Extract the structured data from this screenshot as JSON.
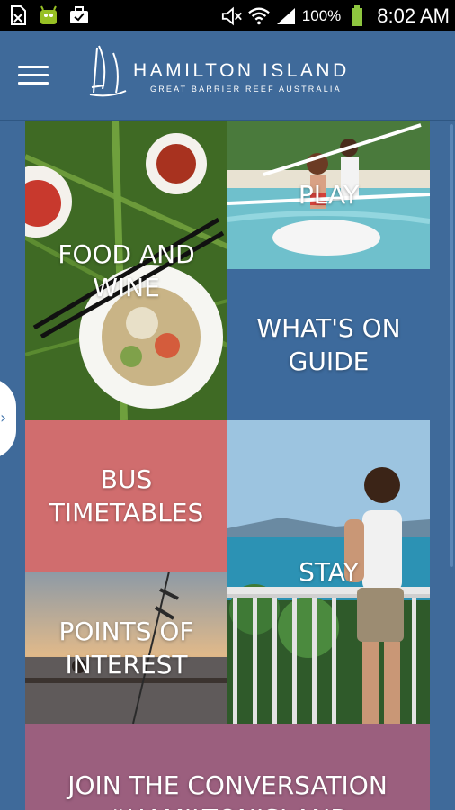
{
  "status": {
    "battery": "100%",
    "time": "8:02 AM",
    "icons": [
      "sim-card-icon",
      "android-icon",
      "briefcase-icon",
      "mute-icon",
      "wifi-icon",
      "signal-icon",
      "battery-icon"
    ]
  },
  "header": {
    "title": "HAMILTON ISLAND",
    "subtitle": "GREAT BARRIER REEF AUSTRALIA"
  },
  "tiles": {
    "food": "FOOD AND WINE",
    "play": "PLAY",
    "whats_on": "WHAT'S ON GUIDE",
    "bus": "BUS TIMETABLES",
    "stay": "STAY",
    "points": "POINTS OF INTEREST",
    "join": "JOIN THE CONVERSATION #HAMILTONISLAND"
  },
  "colors": {
    "background": "#3f6a9a",
    "whats_on": "#3d6a9c",
    "bus": "#d06d6e",
    "join": "#9b5f7e"
  }
}
